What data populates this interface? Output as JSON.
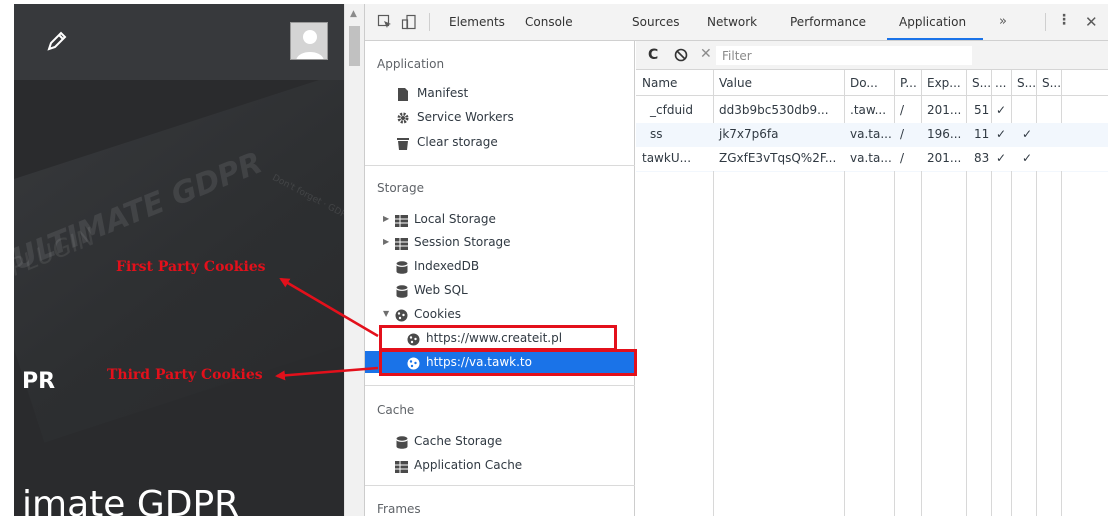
{
  "website": {
    "watermark_line1": "ULTIMATE GDPR",
    "watermark_line2": "PLUGIN",
    "watermark_small": "Don't forget · GDPR Comp",
    "heading_partial": "PR",
    "big_heading_partial": "imate GDPR"
  },
  "devtools": {
    "tabs": [
      "Elements",
      "Console",
      "Sources",
      "Network",
      "Performance",
      "Application"
    ],
    "active_tab": "Application",
    "overflow": "»",
    "menu_icon": "⋮",
    "close_icon": "✕"
  },
  "sidebar": {
    "application_title": "Application",
    "application_items": [
      "Manifest",
      "Service Workers",
      "Clear storage"
    ],
    "storage_title": "Storage",
    "storage_items": [
      "Local Storage",
      "Session Storage",
      "IndexedDB",
      "Web SQL",
      "Cookies"
    ],
    "cookie_origins": [
      "https://www.createit.pl",
      "https://va.tawk.to"
    ],
    "selected_origin": "https://va.tawk.to",
    "cache_title": "Cache",
    "cache_items": [
      "Cache Storage",
      "Application Cache"
    ],
    "frames_title": "Frames"
  },
  "cookies": {
    "filter_placeholder": "Filter",
    "headers": [
      "Name",
      "Value",
      "Do...",
      "P...",
      "Exp...",
      "S...",
      "...",
      "S...",
      "S..."
    ],
    "rows": [
      [
        "_cfduid",
        "dd3b9bc530db9...",
        ".taw...",
        "/",
        "201...",
        "51",
        "✓",
        ""
      ],
      [
        "ss",
        "jk7x7p6fa",
        "va.ta...",
        "/",
        "196...",
        "11",
        "✓",
        "✓"
      ],
      [
        "tawkU...",
        "ZGxfE3vTqsQ%2F...",
        "va.ta...",
        "/",
        "201...",
        "83",
        "✓",
        "✓"
      ]
    ]
  },
  "annotations": {
    "first_party": "First Party Cookies",
    "third_party": "Third Party Cookies"
  },
  "colors": {
    "accent": "#1a73e8",
    "annotation": "#e3101b"
  }
}
